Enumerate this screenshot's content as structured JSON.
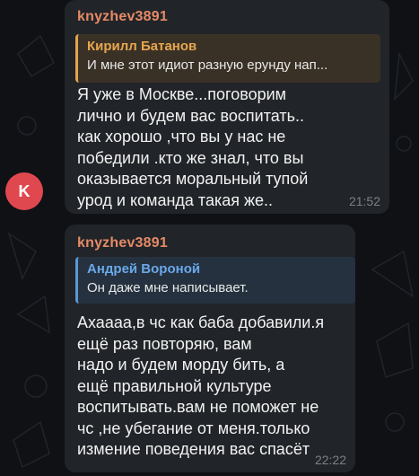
{
  "messages": [
    {
      "sender": "knyzhev3891",
      "reply": {
        "name": "Кирилл Батанов",
        "text": "И мне этот идиот разную ерунду нап..."
      },
      "text": "Я уже в Москве...поговорим\nлично и будем вас воспитать..\nкак хорошо ,что вы у нас не\nпобедили .кто же знал, что вы\nоказывается моральный тупой\nурод и команда такая же..",
      "time": "21:52"
    },
    {
      "sender": "knyzhev3891",
      "reply": {
        "name": "Андрей Вороной",
        "text": "Он даже мне написывает."
      },
      "text": "Ахаааа,в чс как баба добавили.я\nещё раз повторяю, вам\nнадо и будем морду бить, а\nещё правильной культуре\nвоспитывать.вам не поможет не\nчс ,не убегание от меня.только\nизмение поведения вас спасёт",
      "time": "22:22"
    }
  ],
  "avatar": {
    "letter": "K",
    "color": "#e0484f"
  },
  "colors": {
    "background": "#0f1115",
    "bubble": "#212428",
    "sender": "#e58a67",
    "reply1_accent": "#e3a44d",
    "reply2_accent": "#5a96d8"
  }
}
